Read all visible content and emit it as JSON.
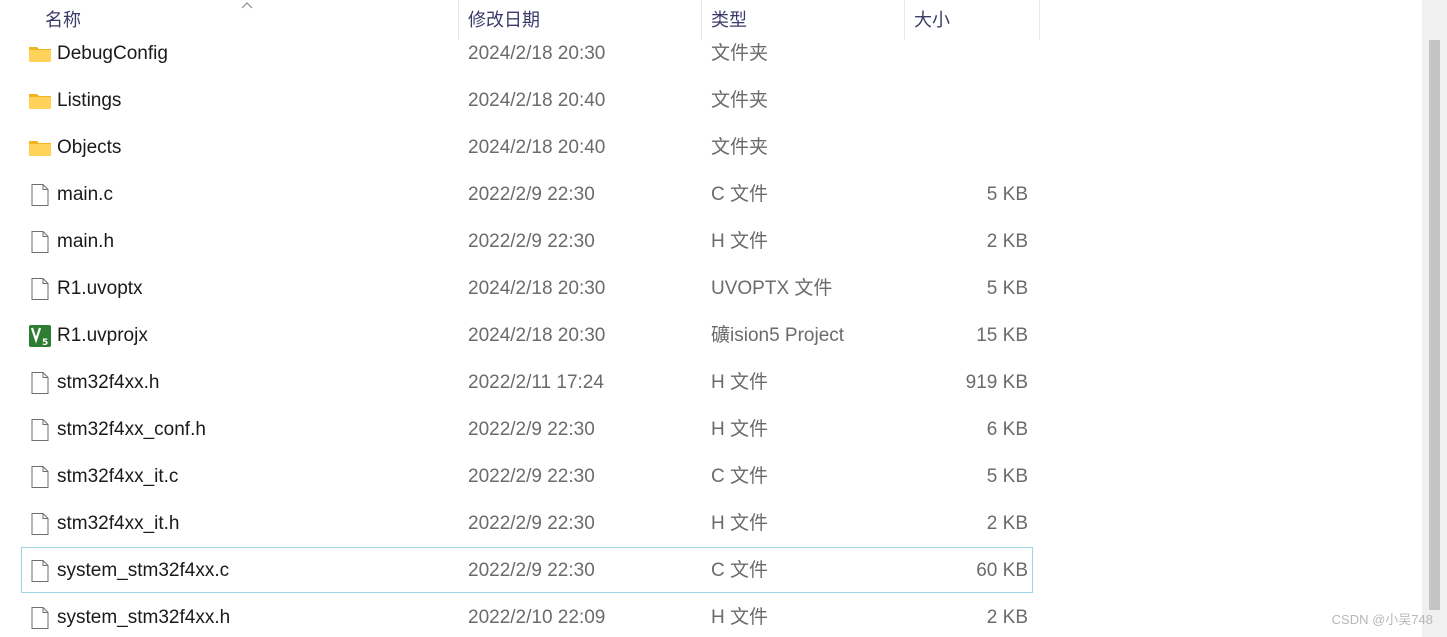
{
  "headers": {
    "name": "名称",
    "date": "修改日期",
    "type": "类型",
    "size": "大小"
  },
  "files": [
    {
      "name": "DebugConfig",
      "date": "2024/2/18 20:30",
      "type": "文件夹",
      "size": "",
      "icon": "folder-icon"
    },
    {
      "name": "Listings",
      "date": "2024/2/18 20:40",
      "type": "文件夹",
      "size": "",
      "icon": "folder-icon"
    },
    {
      "name": "Objects",
      "date": "2024/2/18 20:40",
      "type": "文件夹",
      "size": "",
      "icon": "folder-icon"
    },
    {
      "name": "main.c",
      "date": "2022/2/9 22:30",
      "type": "C 文件",
      "size": "5 KB",
      "icon": "file-icon"
    },
    {
      "name": "main.h",
      "date": "2022/2/9 22:30",
      "type": "H 文件",
      "size": "2 KB",
      "icon": "file-icon"
    },
    {
      "name": "R1.uvoptx",
      "date": "2024/2/18 20:30",
      "type": "UVOPTX 文件",
      "size": "5 KB",
      "icon": "file-icon"
    },
    {
      "name": "R1.uvprojx",
      "date": "2024/2/18 20:30",
      "type": "礦ision5 Project",
      "size": "15 KB",
      "icon": "keil-project-icon"
    },
    {
      "name": "stm32f4xx.h",
      "date": "2022/2/11 17:24",
      "type": "H 文件",
      "size": "919 KB",
      "icon": "file-icon"
    },
    {
      "name": "stm32f4xx_conf.h",
      "date": "2022/2/9 22:30",
      "type": "H 文件",
      "size": "6 KB",
      "icon": "file-icon"
    },
    {
      "name": "stm32f4xx_it.c",
      "date": "2022/2/9 22:30",
      "type": "C 文件",
      "size": "5 KB",
      "icon": "file-icon"
    },
    {
      "name": "stm32f4xx_it.h",
      "date": "2022/2/9 22:30",
      "type": "H 文件",
      "size": "2 KB",
      "icon": "file-icon"
    },
    {
      "name": "system_stm32f4xx.c",
      "date": "2022/2/9 22:30",
      "type": "C 文件",
      "size": "60 KB",
      "icon": "file-icon",
      "selected": true
    },
    {
      "name": "system_stm32f4xx.h",
      "date": "2022/2/10 22:09",
      "type": "H 文件",
      "size": "2 KB",
      "icon": "file-icon"
    }
  ],
  "colors": {
    "selection_border": "#9fd3e6",
    "folder": "#f5c342",
    "keil_green": "#2e7d32"
  },
  "watermark": "CSDN @小吴748"
}
